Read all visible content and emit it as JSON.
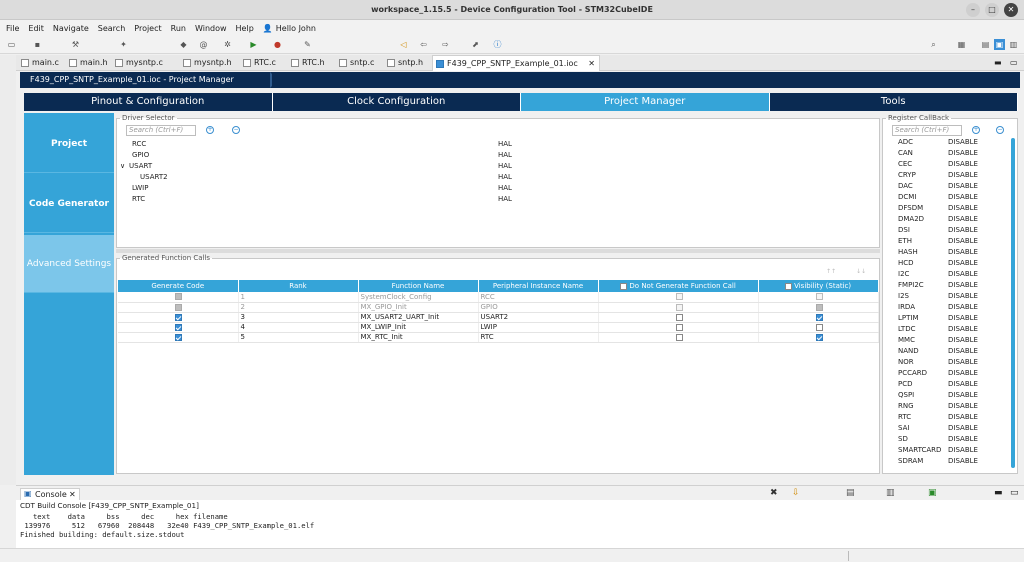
{
  "window": {
    "title": "workspace_1.15.5 - Device Configuration Tool - STM32CubeIDE"
  },
  "menu": [
    "File",
    "Edit",
    "Navigate",
    "Search",
    "Project",
    "Run",
    "Window",
    "Help"
  ],
  "user": {
    "label": "Hello John"
  },
  "editor_tabs": [
    {
      "label": "main.c"
    },
    {
      "label": "main.h"
    },
    {
      "label": "mysntp.c"
    },
    {
      "label": "mysntp.h"
    },
    {
      "label": "RTC.c"
    },
    {
      "label": "RTC.h"
    },
    {
      "label": "sntp.c"
    },
    {
      "label": "sntp.h"
    },
    {
      "label": "F439_CPP_SNTP_Example_01.ioc",
      "active": true
    }
  ],
  "breadcrumb": "F439_CPP_SNTP_Example_01.ioc - Project Manager",
  "main_tabs": [
    "Pinout & Configuration",
    "Clock Configuration",
    "Project Manager",
    "Tools"
  ],
  "side": [
    "Project",
    "Code Generator",
    "Advanced Settings"
  ],
  "driver_selector": {
    "title": "Driver Selector",
    "search_placeholder": "Search (Ctrl+F)",
    "rows": [
      {
        "name": "RCC",
        "value": "HAL"
      },
      {
        "name": "GPIO",
        "value": "HAL"
      },
      {
        "name": "USART",
        "value": "HAL"
      },
      {
        "name": "USART2",
        "value": "HAL"
      },
      {
        "name": "LWIP",
        "value": "HAL"
      },
      {
        "name": "RTC",
        "value": "HAL"
      }
    ]
  },
  "gfc": {
    "title": "Generated Function Calls",
    "headers": [
      "Generate Code",
      "Rank",
      "Function Name",
      "Peripheral Instance Name",
      "Do Not Generate Function Call",
      "Visibility (Static)"
    ],
    "rows": [
      {
        "rank": "1",
        "fn": "SystemClock_Config",
        "inst": "RCC"
      },
      {
        "rank": "2",
        "fn": "MX_GPIO_Init",
        "inst": "GPIO"
      },
      {
        "rank": "3",
        "fn": "MX_USART2_UART_Init",
        "inst": "USART2"
      },
      {
        "rank": "4",
        "fn": "MX_LWIP_Init",
        "inst": "LWIP"
      },
      {
        "rank": "5",
        "fn": "MX_RTC_Init",
        "inst": "RTC"
      }
    ]
  },
  "register_callback": {
    "title": "Register CallBack",
    "search_placeholder": "Search (Ctrl+F)",
    "rows": [
      {
        "n": "ADC",
        "v": "DISABLE"
      },
      {
        "n": "CAN",
        "v": "DISABLE"
      },
      {
        "n": "CEC",
        "v": "DISABLE"
      },
      {
        "n": "CRYP",
        "v": "DISABLE"
      },
      {
        "n": "DAC",
        "v": "DISABLE"
      },
      {
        "n": "DCMI",
        "v": "DISABLE"
      },
      {
        "n": "DFSDM",
        "v": "DISABLE"
      },
      {
        "n": "DMA2D",
        "v": "DISABLE"
      },
      {
        "n": "DSI",
        "v": "DISABLE"
      },
      {
        "n": "ETH",
        "v": "DISABLE"
      },
      {
        "n": "HASH",
        "v": "DISABLE"
      },
      {
        "n": "HCD",
        "v": "DISABLE"
      },
      {
        "n": "I2C",
        "v": "DISABLE"
      },
      {
        "n": "FMPI2C",
        "v": "DISABLE"
      },
      {
        "n": "I2S",
        "v": "DISABLE"
      },
      {
        "n": "IRDA",
        "v": "DISABLE"
      },
      {
        "n": "LPTIM",
        "v": "DISABLE"
      },
      {
        "n": "LTDC",
        "v": "DISABLE"
      },
      {
        "n": "MMC",
        "v": "DISABLE"
      },
      {
        "n": "NAND",
        "v": "DISABLE"
      },
      {
        "n": "NOR",
        "v": "DISABLE"
      },
      {
        "n": "PCCARD",
        "v": "DISABLE"
      },
      {
        "n": "PCD",
        "v": "DISABLE"
      },
      {
        "n": "QSPI",
        "v": "DISABLE"
      },
      {
        "n": "RNG",
        "v": "DISABLE"
      },
      {
        "n": "RTC",
        "v": "DISABLE"
      },
      {
        "n": "SAI",
        "v": "DISABLE"
      },
      {
        "n": "SD",
        "v": "DISABLE"
      },
      {
        "n": "SMARTCARD",
        "v": "DISABLE"
      },
      {
        "n": "SDRAM",
        "v": "DISABLE"
      }
    ]
  },
  "console": {
    "tab": "Console",
    "header": "CDT Build Console [F439_CPP_SNTP_Example_01]",
    "lines": [
      "   text    data     bss     dec     hex filename",
      " 139976     512   67960  208448   32e40 F439_CPP_SNTP_Example_01.elf",
      "Finished building: default.size.stdout"
    ]
  }
}
